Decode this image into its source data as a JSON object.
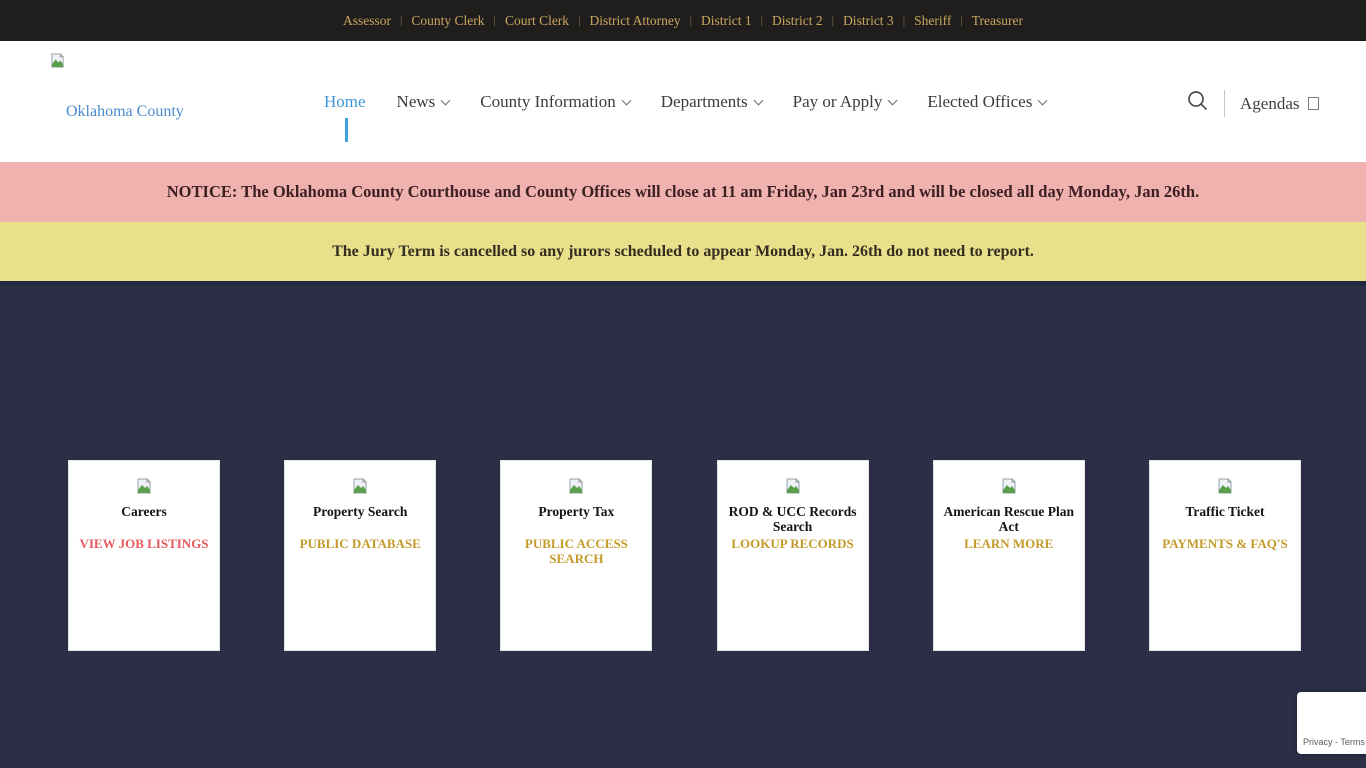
{
  "topbar": {
    "separator": "|",
    "links": [
      {
        "label": "Assessor"
      },
      {
        "label": "County Clerk"
      },
      {
        "label": "Court Clerk"
      },
      {
        "label": "District Attorney"
      },
      {
        "label": "District 1"
      },
      {
        "label": "District 2"
      },
      {
        "label": "District 3"
      },
      {
        "label": "Sheriff"
      },
      {
        "label": "Treasurer"
      }
    ]
  },
  "header": {
    "logo_text": "Oklahoma County",
    "nav": [
      {
        "label": "Home"
      },
      {
        "label": "News"
      },
      {
        "label": "County Information"
      },
      {
        "label": "Departments"
      },
      {
        "label": "Pay or Apply"
      },
      {
        "label": "Elected Offices"
      }
    ],
    "agendas_label": "Agendas"
  },
  "banners": {
    "notice": "NOTICE: The Oklahoma County Courthouse and County Offices will close at 11 am Friday, Jan 23rd and will be closed all day Monday, Jan 26th.",
    "jury": "The Jury Term is cancelled so any jurors scheduled to appear Monday, Jan. 26th do not need to report."
  },
  "cards": [
    {
      "title": "Careers",
      "link": "VIEW JOB LISTINGS",
      "link_color": "#e85a5c"
    },
    {
      "title": "Property Search",
      "link": "PUBLIC DATABASE",
      "link_color": "#c49b2a"
    },
    {
      "title": "Property Tax",
      "link": "PUBLIC ACCESS SEARCH",
      "link_color": "#c49b2a"
    },
    {
      "title": "ROD & UCC Records Search",
      "link": "LOOKUP RECORDS",
      "link_color": "#c49b2a"
    },
    {
      "title": "American Rescue Plan Act",
      "link": "LEARN MORE",
      "link_color": "#c49b2a"
    },
    {
      "title": "Traffic Ticket",
      "link": "PAYMENTS & FAQ'S",
      "link_color": "#c49b2a"
    }
  ],
  "recaptcha": {
    "privacy_terms": "Privacy - Terms"
  },
  "colors": {
    "topbar_bg": "#201d1d",
    "topbar_link": "#c9a75f",
    "header_bg": "#ffffff",
    "logo_blue": "#4a8bd0",
    "nav_active_blue": "#3e97d4",
    "notice_bg": "#f0b2ae",
    "jury_bg": "#e9e08c",
    "main_bg": "#2b2e45",
    "card_bg": "#ffffff",
    "card_link_red": "#e85a5c",
    "card_link_gold": "#c49b2a"
  },
  "icons": {
    "broken_image": "broken-image-icon",
    "search": "search-icon",
    "agendas_glyph": "missing-glyph-icon"
  }
}
